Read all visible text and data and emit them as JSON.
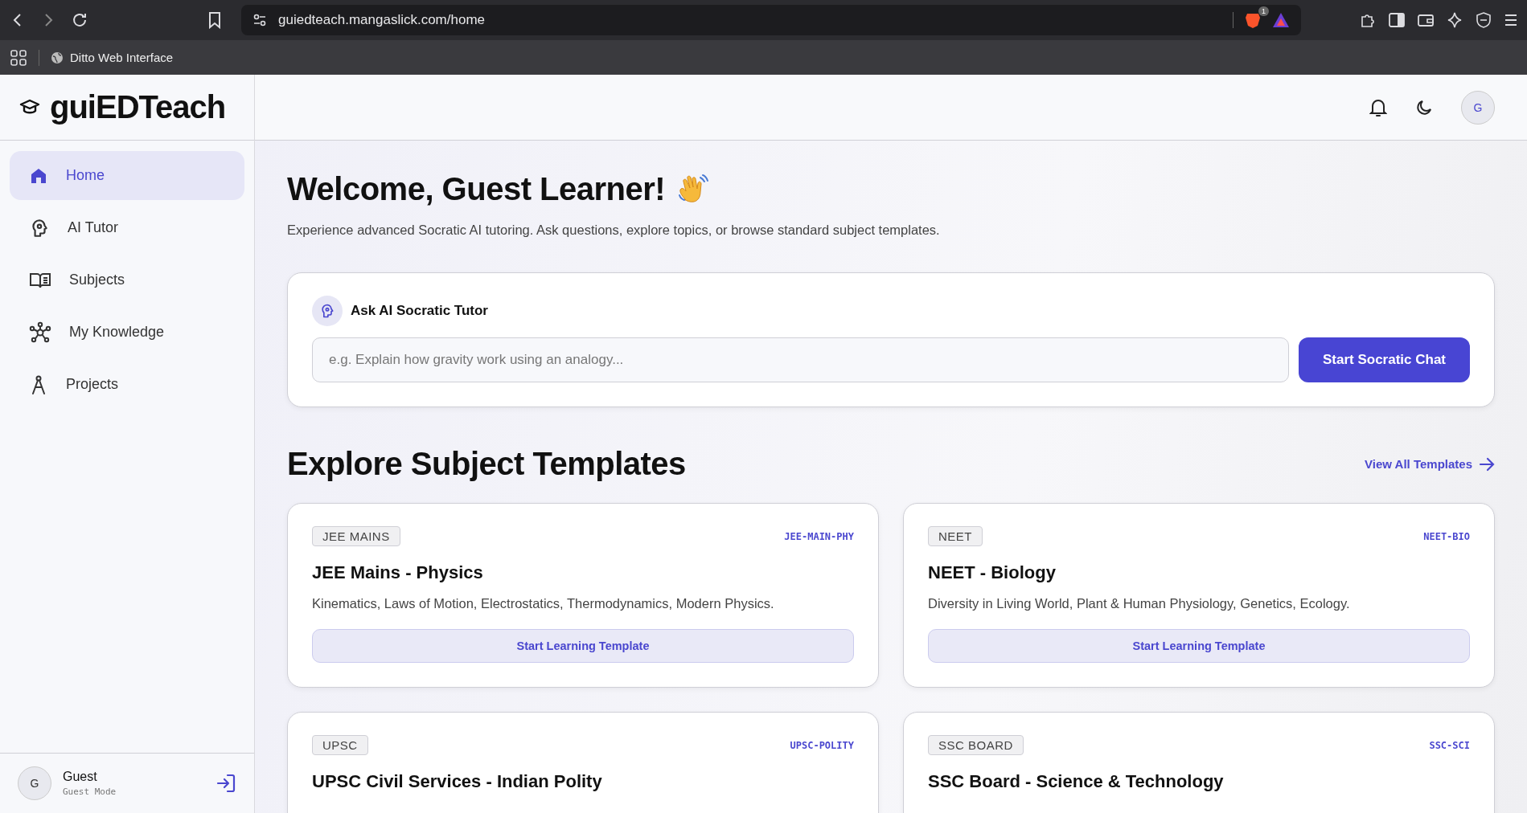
{
  "browser": {
    "url": "guiedteach.mangaslick.com/home",
    "extension_badge": "1",
    "bookmarks": [
      {
        "label": "Ditto Web Interface"
      }
    ]
  },
  "sidebar": {
    "logo": "guiEDTeach",
    "items": [
      {
        "label": "Home",
        "selected": true
      },
      {
        "label": "AI Tutor",
        "selected": false
      },
      {
        "label": "Subjects",
        "selected": false
      },
      {
        "label": "My Knowledge",
        "selected": false
      },
      {
        "label": "Projects",
        "selected": false
      }
    ],
    "user": {
      "avatar": "G",
      "name": "Guest",
      "mode": "Guest Mode"
    }
  },
  "header": {
    "avatar": "G"
  },
  "welcome": {
    "title": "Welcome, Guest Learner!",
    "subtitle": "Experience advanced Socratic AI tutoring. Ask questions, explore topics, or browse standard subject templates."
  },
  "ask": {
    "title": "Ask AI Socratic Tutor",
    "placeholder": "e.g. Explain how gravity work using an analogy...",
    "button": "Start Socratic Chat"
  },
  "templates": {
    "heading": "Explore Subject Templates",
    "link": "View All Templates",
    "cards": [
      {
        "tag": "JEE MAINS",
        "code": "JEE-MAIN-PHY",
        "title": "JEE Mains - Physics",
        "description": "Kinematics, Laws of Motion, Electrostatics, Thermodynamics, Modern Physics.",
        "button": "Start Learning Template"
      },
      {
        "tag": "NEET",
        "code": "NEET-BIO",
        "title": "NEET - Biology",
        "description": "Diversity in Living World, Plant & Human Physiology, Genetics, Ecology.",
        "button": "Start Learning Template"
      },
      {
        "tag": "UPSC",
        "code": "UPSC-POLITY",
        "title": "UPSC Civil Services - Indian Polity"
      },
      {
        "tag": "SSC BOARD",
        "code": "SSC-SCI",
        "title": "SSC Board - Science & Technology"
      }
    ]
  }
}
